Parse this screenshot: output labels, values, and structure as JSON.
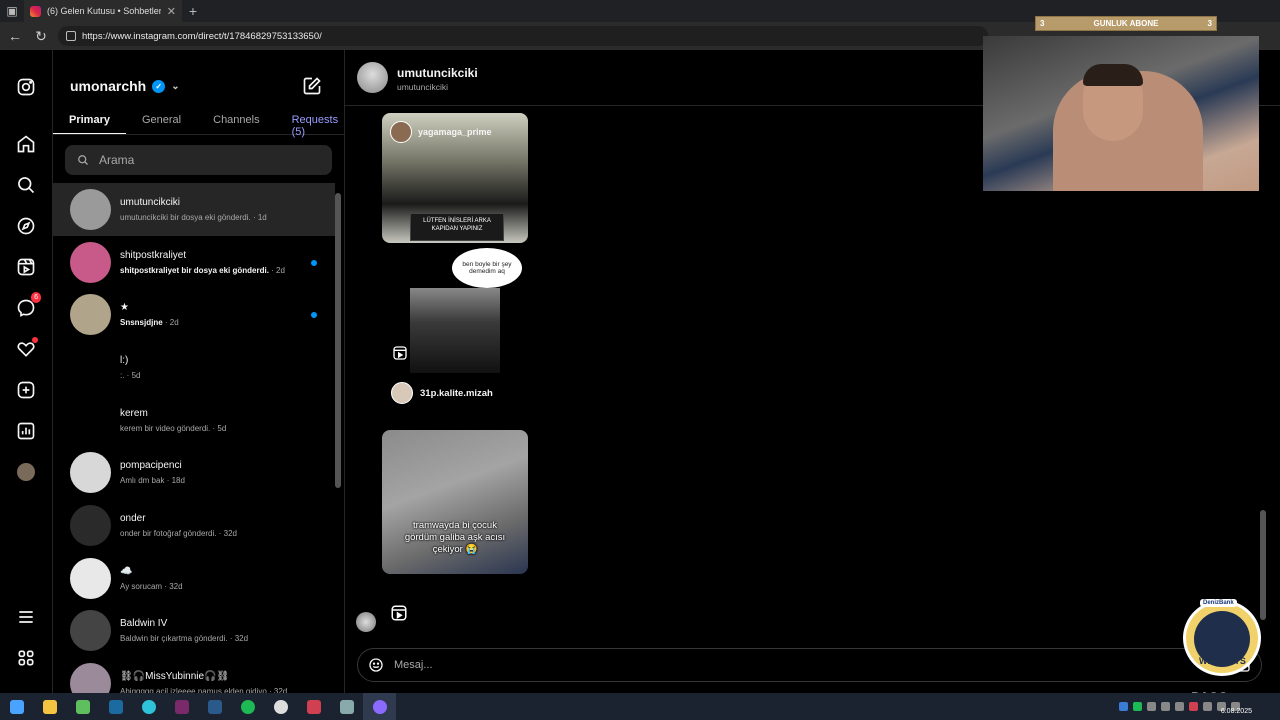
{
  "browser": {
    "tab_title": "(6) Gelen Kutusu • Sohbetler",
    "url": "https://www.instagram.com/direct/t/17846829753133650/"
  },
  "overlay": {
    "sub_bar_left": "3",
    "sub_bar_label": "GUNLUK ABONE",
    "sub_bar_right": "3",
    "sponsor_label": "DenizBank",
    "sponsor_text": "WILDCATS",
    "pass_text": "PASS",
    "clock_date": "6.08.2025"
  },
  "leftnav": {
    "messages_badge": "6",
    "icons": [
      "instagram-logo-icon",
      "home-icon",
      "search-icon",
      "explore-icon",
      "reels-icon",
      "messages-icon",
      "notifications-icon",
      "create-icon",
      "dashboard-icon",
      "profile-icon",
      "menu-icon",
      "more-icon"
    ]
  },
  "inbox": {
    "username": "umonarchh",
    "tabs": [
      "Primary",
      "General",
      "Channels",
      "Requests (5)"
    ],
    "search_placeholder": "Arama",
    "conversations": [
      {
        "name": "umutuncikciki",
        "last": "umutuncikciki bir dosya eki gönderdi.",
        "time": "1d",
        "avatar": "#9a9a9a"
      },
      {
        "name": "shitpostkraliyet",
        "last": "shitpostkraliyet bir dosya eki gönderdi.",
        "time": "2d",
        "avatar": "#c85a8a"
      },
      {
        "name": "★",
        "last": "Snsnsjdjne",
        "time": "2d",
        "avatar": "#b0a58a"
      },
      {
        "name": "l:)",
        "last": ":.",
        "time": "5d",
        "avatar": "#000000"
      },
      {
        "name": "kerem",
        "last": "kerem bir video gönderdi.",
        "time": "5d",
        "avatar": "#000000"
      },
      {
        "name": "pompacipenci",
        "last": "Amlı dm bak",
        "time": "18d",
        "avatar": "#d8d8d8"
      },
      {
        "name": "onder",
        "last": "onder bir fotoğraf gönderdi.",
        "time": "32d",
        "avatar": "#2a2a2a"
      },
      {
        "name": "☁️",
        "last": "Ay sorucam",
        "time": "32d",
        "avatar": "#e8e8e8"
      },
      {
        "name": "Baldwin IV",
        "last": "Baldwin bir çıkartma gönderdi.",
        "time": "32d",
        "avatar": "#444444"
      },
      {
        "name": "⛓🎧MissYubinnie🎧⛓",
        "last": "Abiggggg acil izleeee namus elden gidiyo",
        "time": "32d",
        "avatar": "#9a8a9a"
      }
    ]
  },
  "chat": {
    "name": "umutuncikciki",
    "username": "umutuncikciki",
    "post1_owner": "yagamaga_prime",
    "post1_sign": "LÜTFEN İNİSLERİ ARKA KAPIDAN YAPINIZ",
    "post2_bubble": "ben boyle bir şey demedim aq",
    "post2_owner": "31p.kalite.mizah",
    "post3_caption": "tramwayda bi çocuk gördüm galiba aşk acısı çekiyor 😭",
    "composer_placeholder": "Mesaj..."
  }
}
